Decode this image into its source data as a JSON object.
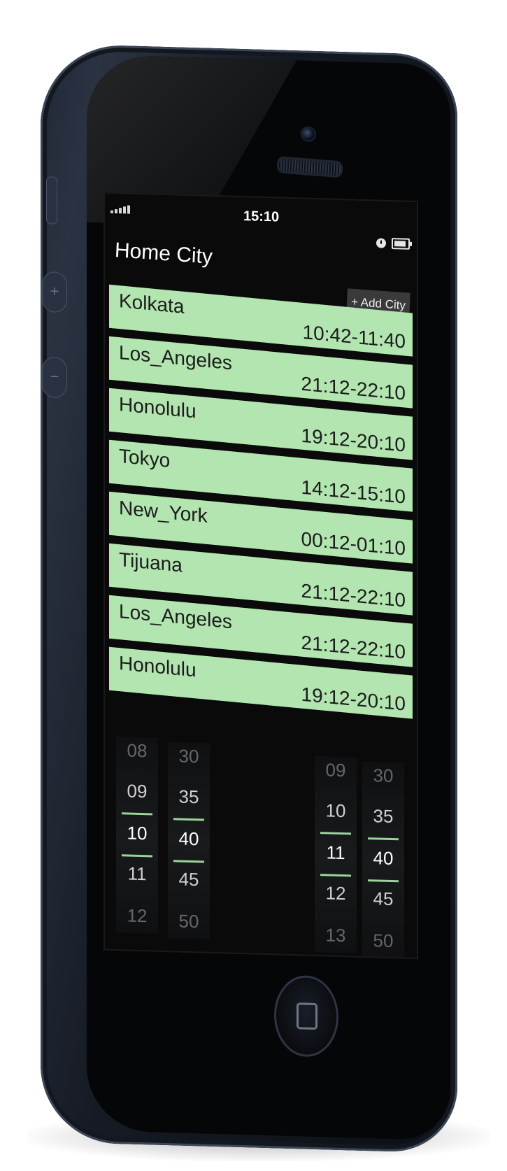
{
  "status_bar": {
    "time": "15:10",
    "signal_icon": "signal-bars-icon",
    "alarm_icon": "alarm-clock-icon",
    "battery_icon": "battery-icon"
  },
  "header": {
    "title": "Home City",
    "add_city_label": "+ Add City"
  },
  "cities": [
    {
      "name": "Kolkata",
      "range": "10:42-11:40"
    },
    {
      "name": "Los_Angeles",
      "range": "21:12-22:10"
    },
    {
      "name": "Honolulu",
      "range": "19:12-20:10"
    },
    {
      "name": "Tokyo",
      "range": "14:12-15:10"
    },
    {
      "name": "New_York",
      "range": "00:12-01:10"
    },
    {
      "name": "Tijuana",
      "range": "21:12-22:10"
    },
    {
      "name": "Los_Angeles",
      "range": "21:12-22:10"
    },
    {
      "name": "Honolulu",
      "range": "19:12-20:10"
    }
  ],
  "pickers": {
    "start_hour": [
      "08",
      "09",
      "10",
      "11",
      "12"
    ],
    "start_minute": [
      "30",
      "35",
      "40",
      "45",
      "50"
    ],
    "end_hour": [
      "09",
      "10",
      "11",
      "12",
      "13"
    ],
    "end_minute": [
      "30",
      "35",
      "40",
      "45",
      "50"
    ]
  },
  "colors": {
    "row_green": "#b2e5b0",
    "selection_line": "#9ed19c",
    "screen_bg": "#0a0a0a"
  }
}
